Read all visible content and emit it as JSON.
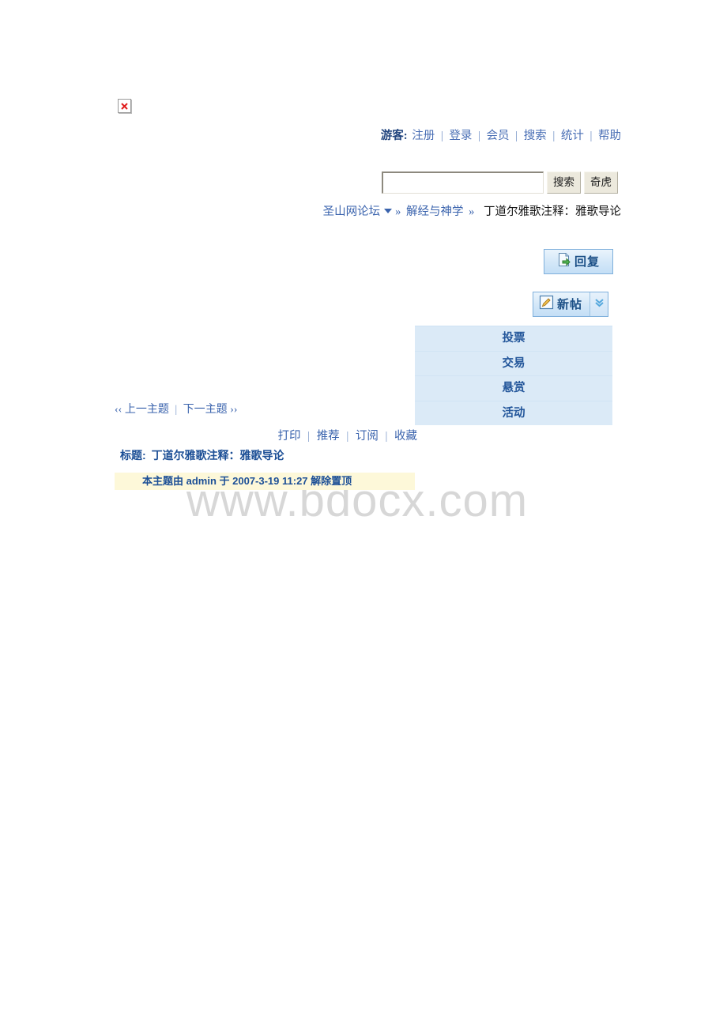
{
  "broken_image": {
    "alt_icon": "broken-image-x"
  },
  "usernav": {
    "guest_label": "游客:",
    "links": [
      {
        "label": "注册"
      },
      {
        "label": "登录"
      },
      {
        "label": "会员"
      },
      {
        "label": "搜索"
      },
      {
        "label": "统计"
      },
      {
        "label": "帮助"
      }
    ],
    "separator": "|"
  },
  "search": {
    "value": "",
    "placeholder": "",
    "submit_label": "搜索",
    "partner_label": "奇虎"
  },
  "breadcrumb": {
    "root": "圣山网论坛",
    "dropdown_icon": "triangle-down-icon",
    "arrow": "»",
    "forum": "解经与神学",
    "current": "丁道尔雅歌注释：雅歌导论"
  },
  "actions": {
    "reply_label": "回复",
    "reply_icon": "reply-post-icon",
    "newpost_label": "新帖",
    "newpost_icon": "edit-pencil-icon",
    "newpost_more_icon": "double-chevron-down-icon"
  },
  "dropdown_menu": {
    "items": [
      {
        "label": "投票"
      },
      {
        "label": "交易"
      },
      {
        "label": "悬赏"
      },
      {
        "label": "活动"
      }
    ]
  },
  "topic_nav": {
    "prev_chevron": "‹‹",
    "prev_label": "上一主题",
    "separator": "|",
    "next_label": "下一主题",
    "next_chevron": "››"
  },
  "tools": {
    "links": [
      {
        "label": "打印"
      },
      {
        "label": "推荐"
      },
      {
        "label": "订阅"
      },
      {
        "label": "收藏"
      }
    ],
    "separator": "|"
  },
  "topic": {
    "title_label": "标题:",
    "title": "丁道尔雅歌注释：雅歌导论"
  },
  "notice": {
    "text": "本主题由  admin  于  2007-3-19 11:27  解除置顶",
    "bg_color": "#fdf8d9",
    "text_color": "#1c4f96"
  },
  "watermark": {
    "text": "www.bdocx.com"
  },
  "colors": {
    "link": "#3a63ad",
    "menu_bg": "#dbeaf7",
    "menu_text": "#24579b",
    "button_border": "#7fb0dc"
  }
}
